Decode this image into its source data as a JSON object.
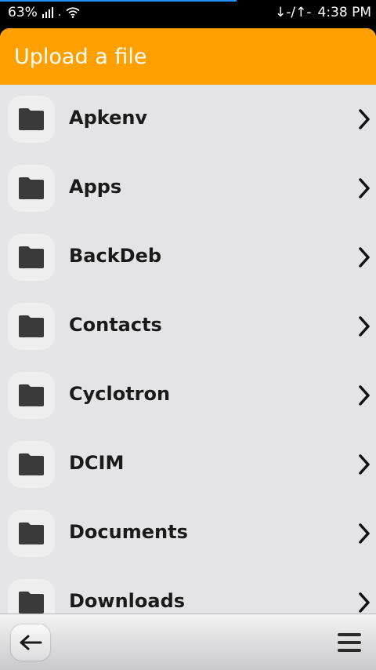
{
  "status_bar": {
    "battery": "63%",
    "transfer": "↓-/↑-",
    "time": "4:38 PM"
  },
  "header": {
    "title": "Upload a file",
    "color": "#ff9f00"
  },
  "folders": [
    {
      "name": "Apkenv"
    },
    {
      "name": "Apps"
    },
    {
      "name": "BackDeb"
    },
    {
      "name": "Contacts"
    },
    {
      "name": "Cyclotron"
    },
    {
      "name": "DCIM"
    },
    {
      "name": "Documents"
    },
    {
      "name": "Downloads"
    }
  ],
  "icons": {
    "folder": "folder-icon",
    "chevron": "chevron-right-icon",
    "back": "back-arrow-icon",
    "menu": "menu-icon"
  }
}
